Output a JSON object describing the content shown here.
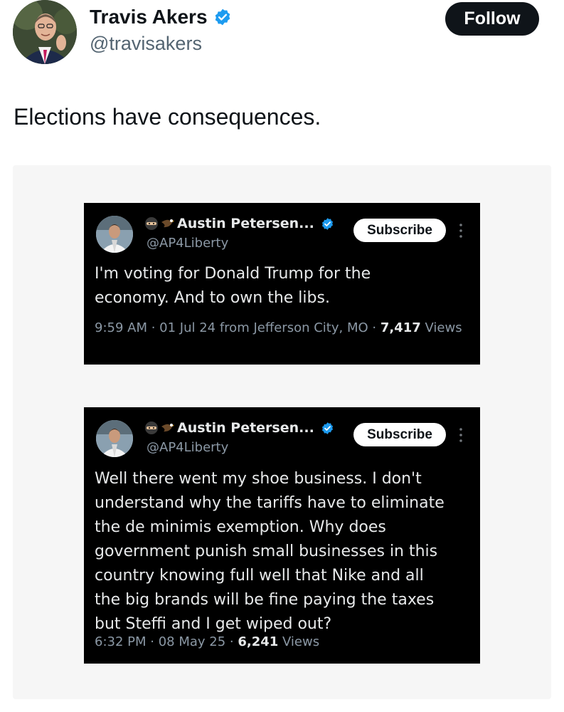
{
  "header": {
    "display_name": "Travis Akers",
    "handle": "@travisakers",
    "follow_label": "Follow"
  },
  "tweet": {
    "text": "Elections have consequences."
  },
  "embedded_tweets": [
    {
      "display_name": "Austin Petersen...",
      "handle": "@AP4Liberty",
      "subscribe_label": "Subscribe",
      "body": "I'm voting for Donald Trump for the\neconomy. And to own the libs.",
      "meta_prefix": "9:59 AM · 01 Jul 24 from Jefferson City, MO · ",
      "views_count": "7,417",
      "views_label": "Views"
    },
    {
      "display_name": "Austin Petersen...",
      "handle": "@AP4Liberty",
      "subscribe_label": "Subscribe",
      "body": "Well there went my shoe business. I don't\nunderstand why the tariffs have to eliminate\nthe de minimis exemption. Why does\ngovernment punish small businesses in this\ncountry knowing full well that Nike and all\nthe big brands will be fine paying the taxes\nbut Steffi and I get wiped out?",
      "meta_prefix": "6:32 PM · 08 May 25 · ",
      "views_count": "6,241",
      "views_label": "Views"
    }
  ],
  "icons": {
    "verified": "verified-badge-icon",
    "more": "more-vertical-icon",
    "ninja_emoji": "ninja-emoji-icon",
    "eagle_emoji": "eagle-emoji-icon"
  },
  "colors": {
    "verified_blue": "#1d9bf0",
    "follow_bg": "#0f1419",
    "card_bg": "#000000",
    "muted_text": "#8b98a5"
  }
}
